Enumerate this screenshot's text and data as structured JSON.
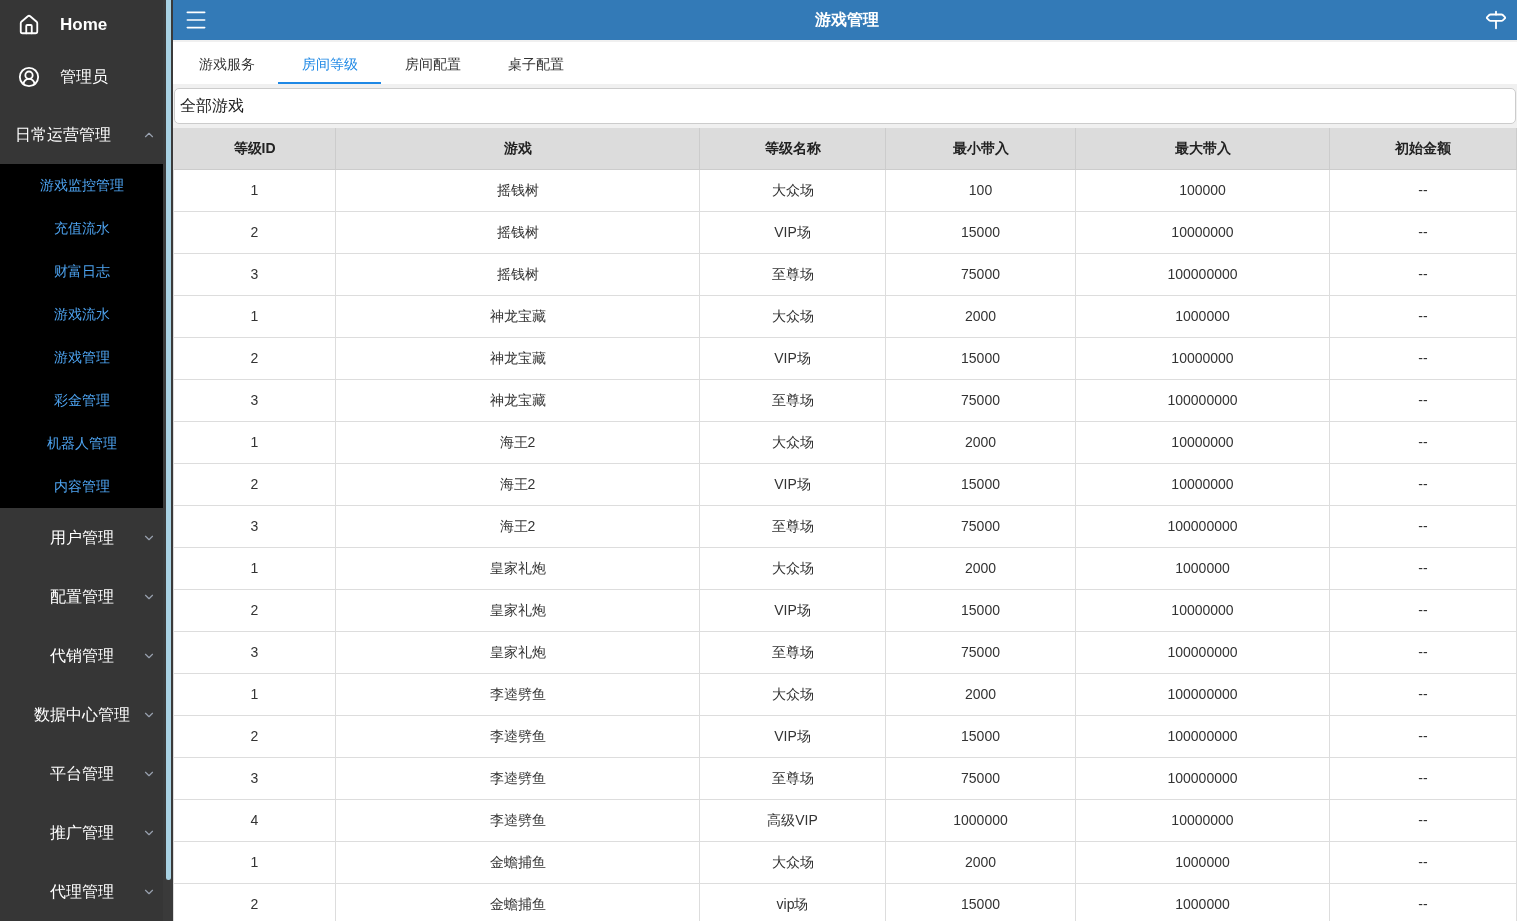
{
  "sidebar": {
    "items": [
      {
        "kind": "home",
        "label": "Home"
      },
      {
        "kind": "user",
        "label": "管理员"
      },
      {
        "kind": "group",
        "label": "日常运营管理",
        "expanded": true,
        "children": [
          {
            "label": "游戏监控管理",
            "selected": false
          },
          {
            "label": "充值流水",
            "selected": false
          },
          {
            "label": "财富日志",
            "selected": false
          },
          {
            "label": "游戏流水",
            "selected": false
          },
          {
            "label": "游戏管理",
            "selected": false
          },
          {
            "label": "彩金管理",
            "selected": false
          },
          {
            "label": "机器人管理",
            "selected": false
          },
          {
            "label": "内容管理",
            "selected": false
          }
        ]
      },
      {
        "kind": "group",
        "label": "用户管理",
        "expanded": false
      },
      {
        "kind": "group",
        "label": "配置管理",
        "expanded": false
      },
      {
        "kind": "group",
        "label": "代销管理",
        "expanded": false
      },
      {
        "kind": "group",
        "label": "数据中心管理",
        "expanded": false
      },
      {
        "kind": "group",
        "label": "平台管理",
        "expanded": false
      },
      {
        "kind": "group",
        "label": "推广管理",
        "expanded": false
      },
      {
        "kind": "group",
        "label": "代理管理",
        "expanded": false
      }
    ]
  },
  "header": {
    "title": "游戏管理"
  },
  "tabs": [
    {
      "label": "游戏服务",
      "selected": false
    },
    {
      "label": "房间等级",
      "selected": true
    },
    {
      "label": "房间配置",
      "selected": false
    },
    {
      "label": "桌子配置",
      "selected": false
    }
  ],
  "filter": {
    "value": "全部游戏"
  },
  "table": {
    "columns": [
      "等级ID",
      "游戏",
      "等级名称",
      "最小带入",
      "最大带入",
      "初始金额"
    ],
    "rows": [
      [
        "1",
        "摇钱树",
        "大众场",
        "100",
        "100000",
        "--"
      ],
      [
        "2",
        "摇钱树",
        "VIP场",
        "15000",
        "10000000",
        "--"
      ],
      [
        "3",
        "摇钱树",
        "至尊场",
        "75000",
        "100000000",
        "--"
      ],
      [
        "1",
        "神龙宝藏",
        "大众场",
        "2000",
        "1000000",
        "--"
      ],
      [
        "2",
        "神龙宝藏",
        "VIP场",
        "15000",
        "10000000",
        "--"
      ],
      [
        "3",
        "神龙宝藏",
        "至尊场",
        "75000",
        "100000000",
        "--"
      ],
      [
        "1",
        "海王2",
        "大众场",
        "2000",
        "10000000",
        "--"
      ],
      [
        "2",
        "海王2",
        "VIP场",
        "15000",
        "10000000",
        "--"
      ],
      [
        "3",
        "海王2",
        "至尊场",
        "75000",
        "100000000",
        "--"
      ],
      [
        "1",
        "皇家礼炮",
        "大众场",
        "2000",
        "1000000",
        "--"
      ],
      [
        "2",
        "皇家礼炮",
        "VIP场",
        "15000",
        "10000000",
        "--"
      ],
      [
        "3",
        "皇家礼炮",
        "至尊场",
        "75000",
        "100000000",
        "--"
      ],
      [
        "1",
        "李逵劈鱼",
        "大众场",
        "2000",
        "100000000",
        "--"
      ],
      [
        "2",
        "李逵劈鱼",
        "VIP场",
        "15000",
        "100000000",
        "--"
      ],
      [
        "3",
        "李逵劈鱼",
        "至尊场",
        "75000",
        "100000000",
        "--"
      ],
      [
        "4",
        "李逵劈鱼",
        "高级VIP",
        "1000000",
        "10000000",
        "--"
      ],
      [
        "1",
        "金蟾捕鱼",
        "大众场",
        "2000",
        "1000000",
        "--"
      ],
      [
        "2",
        "金蟾捕鱼",
        "vip场",
        "15000",
        "1000000",
        "--"
      ]
    ]
  }
}
